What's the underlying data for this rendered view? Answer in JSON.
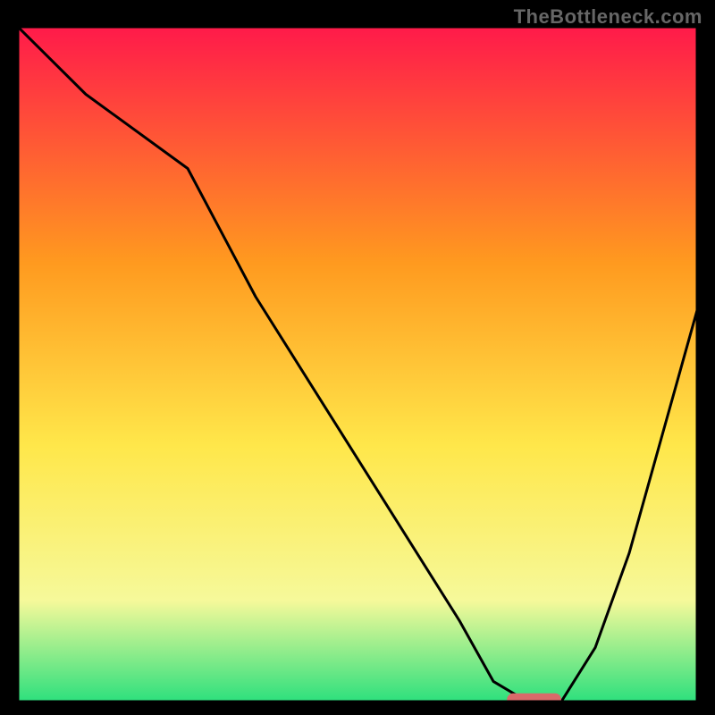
{
  "watermark": "TheBottleneck.com",
  "chart_data": {
    "type": "line",
    "title": "",
    "xlabel": "",
    "ylabel": "",
    "xlim": [
      0,
      100
    ],
    "ylim": [
      0,
      100
    ],
    "gradient_colors": {
      "top": "#ff1a4a",
      "mid_upper": "#ff9a1f",
      "mid": "#ffe74a",
      "mid_lower": "#f6f99a",
      "bottom": "#2de07d"
    },
    "series": [
      {
        "name": "bottleneck-curve",
        "color": "#000000",
        "x": [
          0,
          10,
          25,
          35,
          45,
          55,
          65,
          70,
          75,
          80,
          85,
          90,
          95,
          100
        ],
        "y": [
          100,
          90,
          79,
          60,
          44,
          28,
          12,
          3,
          0,
          0,
          8,
          22,
          40,
          58
        ]
      }
    ],
    "marker": {
      "name": "optimal-range",
      "color": "#d96a6a",
      "x_start": 72,
      "x_end": 80,
      "y": 0.3
    }
  }
}
